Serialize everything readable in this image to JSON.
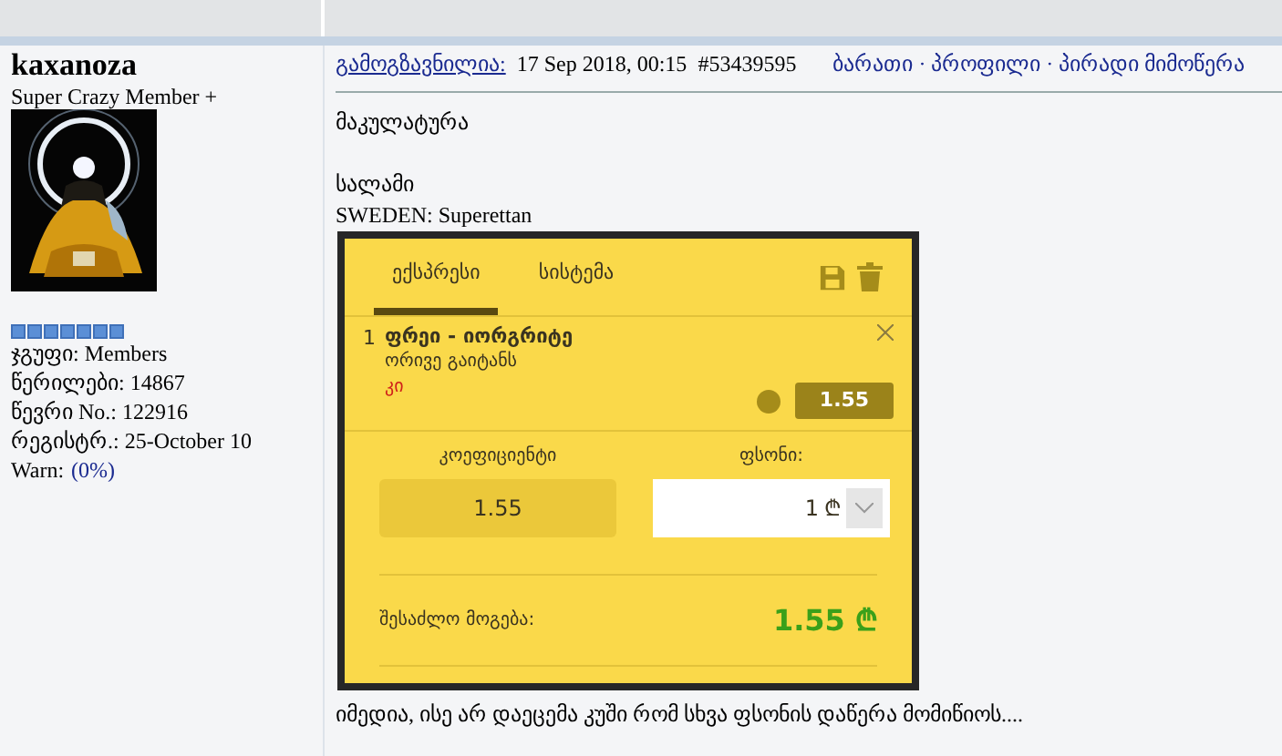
{
  "author": {
    "name": "kaxanoza",
    "rank": "Super Crazy Member +",
    "stars": 7,
    "details": [
      {
        "text": "ჯგუფი: Members",
        "kind": "plain"
      },
      {
        "text": "წერილები: 14867",
        "kind": "plain"
      },
      {
        "text": "წევრი No.: 122916",
        "kind": "plain"
      },
      {
        "text": "რეგისტრ.: 25-October 10",
        "kind": "plain"
      },
      {
        "label": "Warn:",
        "value": "(0%)",
        "kind": "warn"
      }
    ]
  },
  "post": {
    "sent_label": "გამოგზავნილია:",
    "date": "17 Sep 2018, 00:15",
    "number": "#53439595",
    "actions": "ბარათი · პროფილი · პირადი მიმოწერა",
    "paragraphs": [
      [
        "მაკულატურა"
      ],
      [
        "სალამი",
        "SWEDEN: Superettan"
      ]
    ],
    "footer": "იმედია, ისე არ დაეცემა კუში რომ სხვა ფსონის დაწერა მომიწიოს...."
  },
  "betslip": {
    "tabs": [
      {
        "label": "ექსპრესი",
        "selected": true
      },
      {
        "label": "სისტემა",
        "selected": false
      }
    ],
    "bet": {
      "index": "1",
      "match": "ფრეი - იორგრიტე",
      "market": "ორივე გაიტანს",
      "pick": "კი",
      "odds": "1.55"
    },
    "odds_label": "კოეფიციენტი",
    "odds_value": "1.55",
    "stake_label": "ფსონი:",
    "stake_value": "1",
    "currency": "₾",
    "win_label": "შესაძლო მოგება:",
    "win_value": "1.55 ₾"
  }
}
